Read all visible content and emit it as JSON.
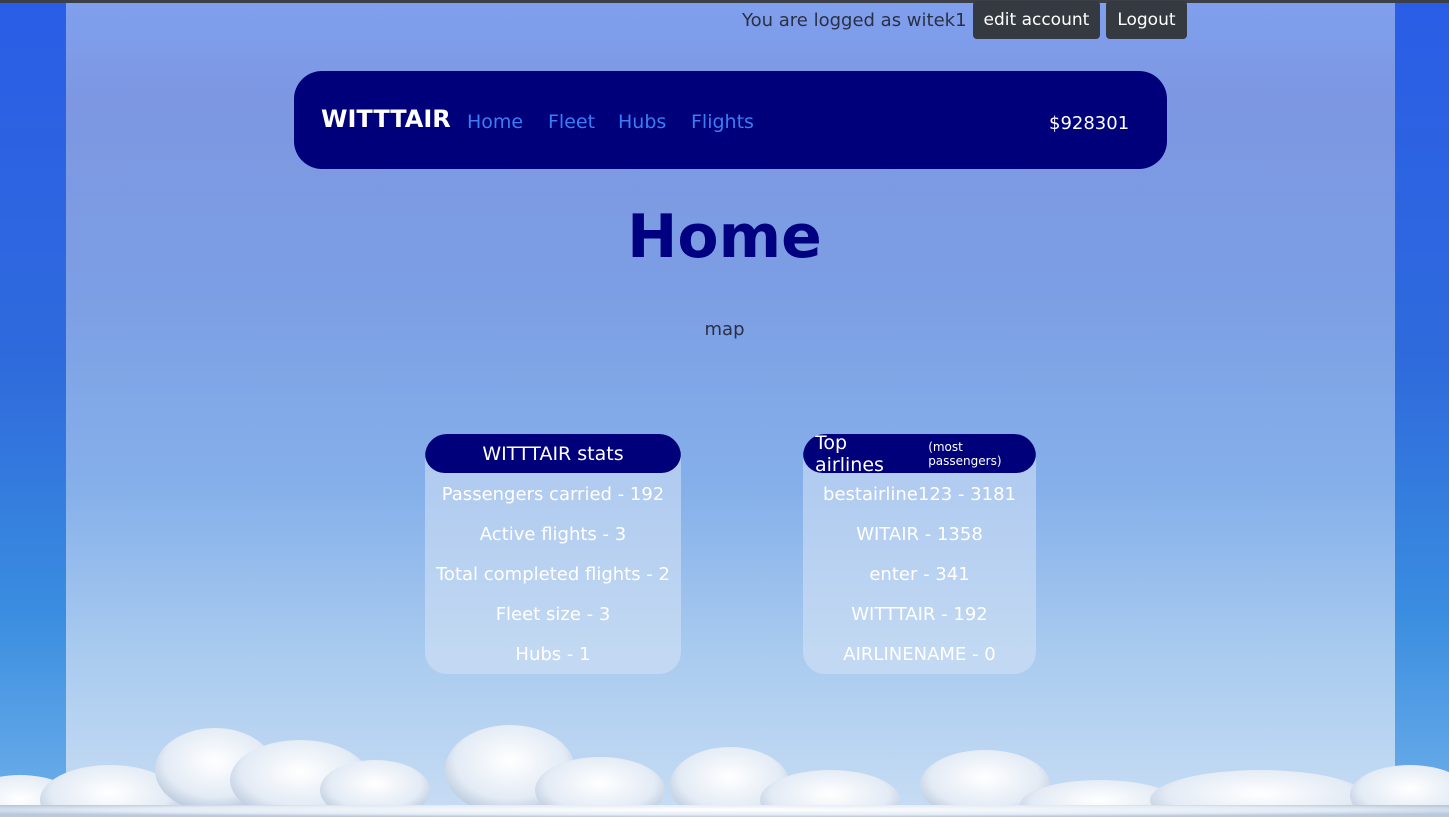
{
  "user_bar": {
    "logged_text": "You are logged as witek1",
    "edit_account_label": "edit account",
    "logout_label": "Logout"
  },
  "navbar": {
    "brand": "WITTTAIR",
    "links": [
      "Home",
      "Fleet",
      "Hubs",
      "Flights"
    ],
    "balance": "$928301"
  },
  "page_title": "Home",
  "map_label": "map",
  "stats_card": {
    "title": "WITTTAIR stats",
    "rows": [
      "Passengers carried - 192",
      "Active flights - 3",
      "Total completed flights - 2",
      "Fleet size - 3",
      "Hubs - 1"
    ]
  },
  "top_airlines_card": {
    "title": "Top airlines",
    "subtitle": "(most passengers)",
    "rows": [
      "bestairline123 - 3181",
      "WITAIR - 1358",
      "enter - 341",
      "WITTTAIR - 192",
      "AIRLINENAME - 0"
    ]
  },
  "colors": {
    "navbar_bg": "#00007a",
    "link": "#3b7df5",
    "title": "#000080",
    "button_dark": "#343a40"
  }
}
